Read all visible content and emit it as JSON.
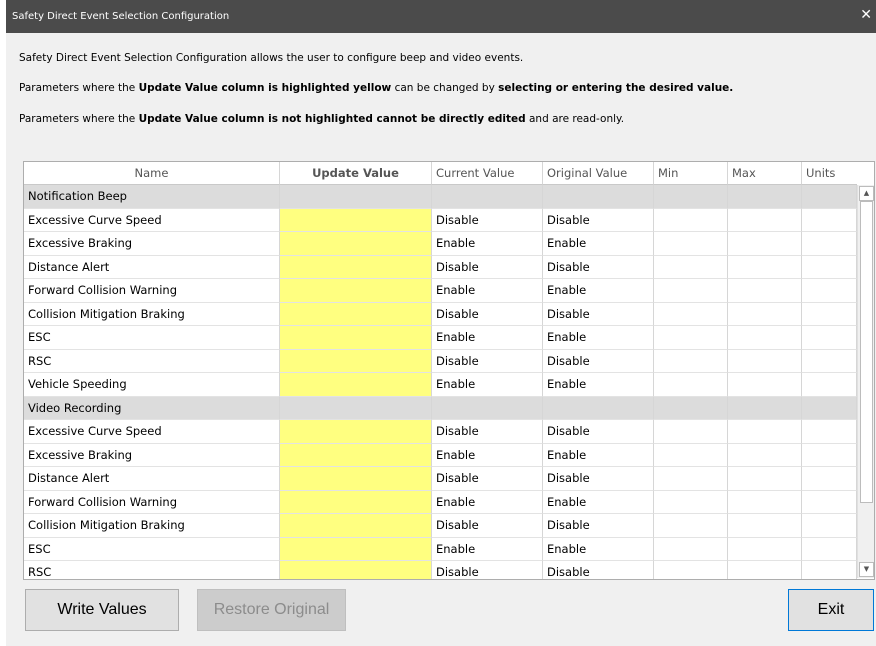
{
  "window": {
    "title": "Safety Direct Event Selection Configuration",
    "close_glyph": "✕"
  },
  "intro": {
    "line1": "Safety Direct Event Selection Configuration allows the user to configure beep and video events.",
    "line2": {
      "a": "Parameters where the ",
      "b": "Update Value column is highlighted yellow",
      "c": " can be changed by ",
      "d": "selecting or entering the desired value."
    },
    "line3": {
      "a": "Parameters where the ",
      "b": "Update Value column is not highlighted cannot be directly edited",
      "c": " and are read-only."
    }
  },
  "table": {
    "columns": [
      "Name",
      "Update Value",
      "Current Value",
      "Original Value",
      "Min",
      "Max",
      "Units"
    ],
    "rows": [
      {
        "type": "group",
        "name": "Notification Beep"
      },
      {
        "type": "item",
        "name": "Excessive Curve Speed",
        "current": "Disable",
        "original": "Disable"
      },
      {
        "type": "item",
        "name": "Excessive Braking",
        "current": "Enable",
        "original": "Enable"
      },
      {
        "type": "item",
        "name": "Distance Alert",
        "current": "Disable",
        "original": "Disable"
      },
      {
        "type": "item",
        "name": "Forward Collision Warning",
        "current": "Enable",
        "original": "Enable"
      },
      {
        "type": "item",
        "name": "Collision Mitigation Braking",
        "current": "Disable",
        "original": "Disable"
      },
      {
        "type": "item",
        "name": "ESC",
        "current": "Enable",
        "original": "Enable"
      },
      {
        "type": "item",
        "name": "RSC",
        "current": "Disable",
        "original": "Disable"
      },
      {
        "type": "item",
        "name": "Vehicle Speeding",
        "current": "Enable",
        "original": "Enable"
      },
      {
        "type": "group",
        "name": "Video Recording"
      },
      {
        "type": "item",
        "name": "Excessive Curve Speed",
        "current": "Disable",
        "original": "Disable"
      },
      {
        "type": "item",
        "name": "Excessive Braking",
        "current": "Enable",
        "original": "Enable"
      },
      {
        "type": "item",
        "name": "Distance Alert",
        "current": "Disable",
        "original": "Disable"
      },
      {
        "type": "item",
        "name": "Forward Collision Warning",
        "current": "Enable",
        "original": "Enable"
      },
      {
        "type": "item",
        "name": "Collision Mitigation Braking",
        "current": "Disable",
        "original": "Disable"
      },
      {
        "type": "item",
        "name": "ESC",
        "current": "Enable",
        "original": "Enable"
      },
      {
        "type": "item",
        "name": "RSC",
        "current": "Disable",
        "original": "Disable"
      }
    ],
    "scroll_up_glyph": "▲",
    "scroll_down_glyph": "▼"
  },
  "buttons": {
    "write": "Write Values",
    "restore": "Restore Original",
    "exit": "Exit"
  },
  "colors": {
    "titlebar": "#4b4b4b",
    "editable_cell": "#ffff80",
    "group_row": "#dcdcdc",
    "exit_border": "#0078d7"
  }
}
